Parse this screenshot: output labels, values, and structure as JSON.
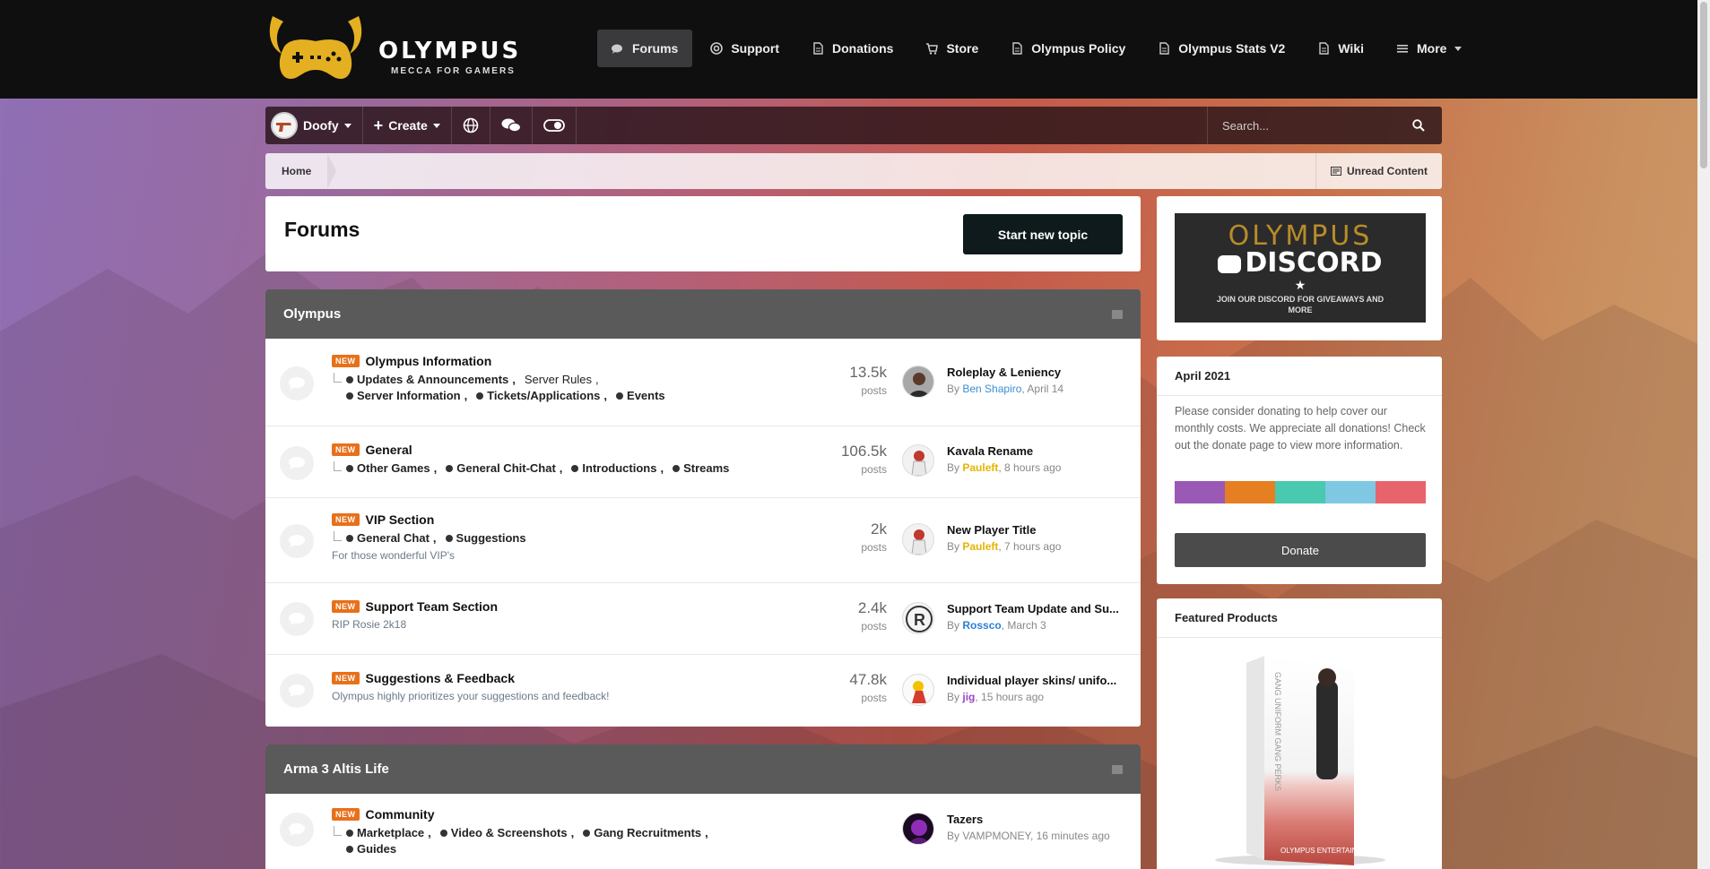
{
  "header": {
    "logo_title": "OLYMPUS",
    "logo_tagline": "MECCA FOR GAMERS",
    "nav": [
      {
        "label": "Forums",
        "icon": "chat-bubbles-icon",
        "active": true
      },
      {
        "label": "Support",
        "icon": "lifebuoy-icon"
      },
      {
        "label": "Donations",
        "icon": "document-icon"
      },
      {
        "label": "Store",
        "icon": "cart-icon"
      },
      {
        "label": "Olympus Policy",
        "icon": "document-icon"
      },
      {
        "label": "Olympus Stats V2",
        "icon": "document-icon"
      },
      {
        "label": "Wiki",
        "icon": "document-icon"
      },
      {
        "label": "More",
        "icon": "menu-icon"
      }
    ]
  },
  "userbar": {
    "username": "Doofy",
    "create_label": "Create",
    "search_placeholder": "Search..."
  },
  "breadcrumb": {
    "home": "Home",
    "unread": "Unread Content"
  },
  "page": {
    "title": "Forums",
    "start_topic": "Start new topic"
  },
  "categories": [
    {
      "name": "Olympus",
      "forums": [
        {
          "badge": "NEW",
          "title": "Olympus Information",
          "subforums": [
            "Updates & Announcements",
            "Server Rules",
            "Server Information",
            "Tickets/Applications",
            "Events"
          ],
          "description": "",
          "posts": "13.5k",
          "posts_label": "posts",
          "last_title": "Roleplay & Leniency",
          "last_by": "By",
          "last_user": "Ben Shapiro",
          "last_time": ", April 14"
        },
        {
          "badge": "NEW",
          "title": "General",
          "subforums": [
            "Other Games",
            "General Chit-Chat",
            "Introductions",
            "Streams"
          ],
          "description": "",
          "posts": "106.5k",
          "posts_label": "posts",
          "last_title": "Kavala Rename",
          "last_by": "By",
          "last_user": "Pauleft",
          "last_time": ", 8 hours ago"
        },
        {
          "badge": "NEW",
          "title": "VIP Section",
          "subforums": [
            "General Chat",
            "Suggestions"
          ],
          "description": "For those wonderful VIP's",
          "posts": "2k",
          "posts_label": "posts",
          "last_title": "New Player Title",
          "last_by": "By",
          "last_user": "Pauleft",
          "last_time": ", 7 hours ago"
        },
        {
          "badge": "NEW",
          "title": "Support Team Section",
          "subforums": [],
          "description": "RIP Rosie 2k18",
          "posts": "2.4k",
          "posts_label": "posts",
          "last_title": "Support Team Update and Su...",
          "last_by": "By",
          "last_user": "Rossco",
          "last_time": ", March 3"
        },
        {
          "badge": "NEW",
          "title": "Suggestions & Feedback",
          "subforums": [],
          "description": "Olympus highly prioritizes your suggestions and feedback!",
          "posts": "47.8k",
          "posts_label": "posts",
          "last_title": "Individual player skins/ unifo...",
          "last_by": "By",
          "last_user": "jig",
          "last_time": ", 15 hours ago"
        }
      ]
    },
    {
      "name": "Arma 3 Altis Life",
      "forums": [
        {
          "badge": "NEW",
          "title": "Community",
          "subforums": [
            "Marketplace",
            "Video & Screenshots",
            "Gang Recruitments",
            "Guides"
          ],
          "description": "",
          "posts": "",
          "posts_label": "",
          "last_title": "Tazers",
          "last_by": "By",
          "last_user": "VAMPMONEY",
          "last_time": ", 16 minutes ago"
        }
      ]
    }
  ],
  "sidebar": {
    "discord": {
      "brand": "OLYMPUS",
      "name": "DISCORD",
      "star": "★",
      "tagline": "JOIN OUR DISCORD FOR GIVEAWAYS AND MORE"
    },
    "donation": {
      "heading": "April 2021",
      "text": "Please consider donating to help cover our monthly costs. We appreciate all donations! Check out the donate page to view more information.",
      "bar_colors": [
        "#9b59b6",
        "#e67e22",
        "#48c9b0",
        "#7ec8e3",
        "#e8646c"
      ],
      "button": "Donate"
    },
    "featured": {
      "heading": "Featured Products",
      "box_side_text": "GANG UNIFORM GANG PERKS",
      "box_footer": "OLYMPUS ENTERTAINMENT"
    }
  }
}
